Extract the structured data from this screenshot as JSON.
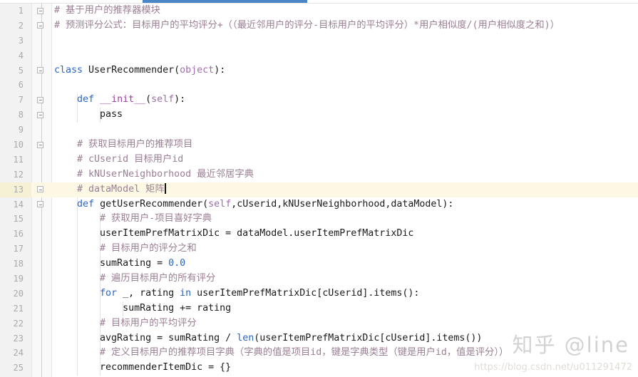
{
  "editor": {
    "language": "Python",
    "highlighted_line": 13,
    "caret_line": 13,
    "tab_accent_color": "#4a86c8",
    "highlight_color": "#fcf8e4",
    "comment_color": "#9b7f93",
    "keyword_color": "#2b65c4",
    "background_color": "#ffffff",
    "gutter_color": "#f2f2f2"
  },
  "line_numbers": [
    "1",
    "2",
    "3",
    "4",
    "5",
    "6",
    "7",
    "8",
    "9",
    "10",
    "11",
    "12",
    "13",
    "14",
    "15",
    "16",
    "17",
    "18",
    "19",
    "20",
    "21",
    "22",
    "23",
    "24",
    "25"
  ],
  "lines": [
    {
      "n": "1",
      "fold": "minus",
      "segments": [
        {
          "t": "# 基于用户的推荐器模块",
          "c": "cmt"
        }
      ]
    },
    {
      "n": "2",
      "fold": "minus",
      "segments": [
        {
          "t": "# 预测评分公式：目标用户的平均评分+（（最近邻用户的评分-目标用户的平均评分）*用户相似度/(用户相似度之和)）",
          "c": "cmt"
        }
      ]
    },
    {
      "n": "3",
      "fold": "",
      "segments": []
    },
    {
      "n": "4",
      "fold": "",
      "segments": []
    },
    {
      "n": "5",
      "fold": "minus",
      "segments": [
        {
          "t": "class ",
          "c": "kw"
        },
        {
          "t": "UserRecommender(",
          "c": "cls"
        },
        {
          "t": "object",
          "c": "self"
        },
        {
          "t": "):",
          "c": "cls"
        }
      ]
    },
    {
      "n": "6",
      "fold": "",
      "segments": []
    },
    {
      "n": "7",
      "fold": "minus",
      "segments": [
        {
          "t": "    ",
          "c": "cls"
        },
        {
          "t": "def ",
          "c": "kw"
        },
        {
          "t": "__init__",
          "c": "fn"
        },
        {
          "t": "(",
          "c": "cls"
        },
        {
          "t": "self",
          "c": "self"
        },
        {
          "t": "):",
          "c": "cls"
        }
      ]
    },
    {
      "n": "8",
      "fold": "minus",
      "segments": [
        {
          "t": "        pass",
          "c": "cls"
        }
      ]
    },
    {
      "n": "9",
      "fold": "",
      "segments": []
    },
    {
      "n": "10",
      "fold": "minus",
      "segments": [
        {
          "t": "    # 获取目标用户的推荐项目",
          "c": "cmt"
        }
      ]
    },
    {
      "n": "11",
      "fold": "",
      "segments": [
        {
          "t": "    # cUserid 目标用户id",
          "c": "cmt"
        }
      ]
    },
    {
      "n": "12",
      "fold": "",
      "segments": [
        {
          "t": "    # kNUserNeighborhood 最近邻居字典",
          "c": "cmt"
        }
      ]
    },
    {
      "n": "13",
      "fold": "minus",
      "segments": [
        {
          "t": "    # dataModel 矩阵",
          "c": "cmt"
        }
      ],
      "caret": true
    },
    {
      "n": "14",
      "fold": "minus",
      "segments": [
        {
          "t": "    ",
          "c": "cls"
        },
        {
          "t": "def ",
          "c": "kw"
        },
        {
          "t": "getUserRecommender(",
          "c": "cls"
        },
        {
          "t": "self",
          "c": "self"
        },
        {
          "t": ",cUserid,kNUserNeighborhood,dataModel):",
          "c": "cls"
        }
      ]
    },
    {
      "n": "15",
      "fold": "",
      "segments": [
        {
          "t": "        # 获取用户-项目喜好字典",
          "c": "cmt"
        }
      ]
    },
    {
      "n": "16",
      "fold": "",
      "segments": [
        {
          "t": "        userItemPrefMatrixDic = dataModel.userItemPrefMatrixDic",
          "c": "cls"
        }
      ]
    },
    {
      "n": "17",
      "fold": "",
      "segments": [
        {
          "t": "        # 目标用户的评分之和",
          "c": "cmt"
        }
      ]
    },
    {
      "n": "18",
      "fold": "",
      "segments": [
        {
          "t": "        sumRating = ",
          "c": "cls"
        },
        {
          "t": "0.0",
          "c": "num"
        }
      ]
    },
    {
      "n": "19",
      "fold": "",
      "segments": [
        {
          "t": "        # 遍历目标用户的所有评分",
          "c": "cmt"
        }
      ]
    },
    {
      "n": "20",
      "fold": "",
      "segments": [
        {
          "t": "        ",
          "c": "cls"
        },
        {
          "t": "for ",
          "c": "kw"
        },
        {
          "t": "_, rating ",
          "c": "cls"
        },
        {
          "t": "in ",
          "c": "kw"
        },
        {
          "t": "userItemPrefMatrixDic[cUserid].items():",
          "c": "cls"
        }
      ]
    },
    {
      "n": "21",
      "fold": "",
      "segments": [
        {
          "t": "            sumRating += rating",
          "c": "cls"
        }
      ]
    },
    {
      "n": "22",
      "fold": "",
      "segments": [
        {
          "t": "        # 目标用户的平均评分",
          "c": "cmt"
        }
      ]
    },
    {
      "n": "23",
      "fold": "",
      "segments": [
        {
          "t": "        avgRating = sumRating / ",
          "c": "cls"
        },
        {
          "t": "len",
          "c": "bi"
        },
        {
          "t": "(userItemPrefMatrixDic[cUserid].items())",
          "c": "cls"
        }
      ]
    },
    {
      "n": "24",
      "fold": "",
      "segments": [
        {
          "t": "        # 定义目标用户的推荐项目字典（字典的值是项目id，键是字典类型（键是用户id，值是评分））",
          "c": "cmt"
        }
      ]
    },
    {
      "n": "25",
      "fold": "",
      "segments": [
        {
          "t": "        recommenderItemDic = {}",
          "c": "cls"
        }
      ]
    }
  ],
  "watermarks": {
    "zhihu": "知乎 @line",
    "url": "https://blog.csdn.net/u011291472"
  }
}
